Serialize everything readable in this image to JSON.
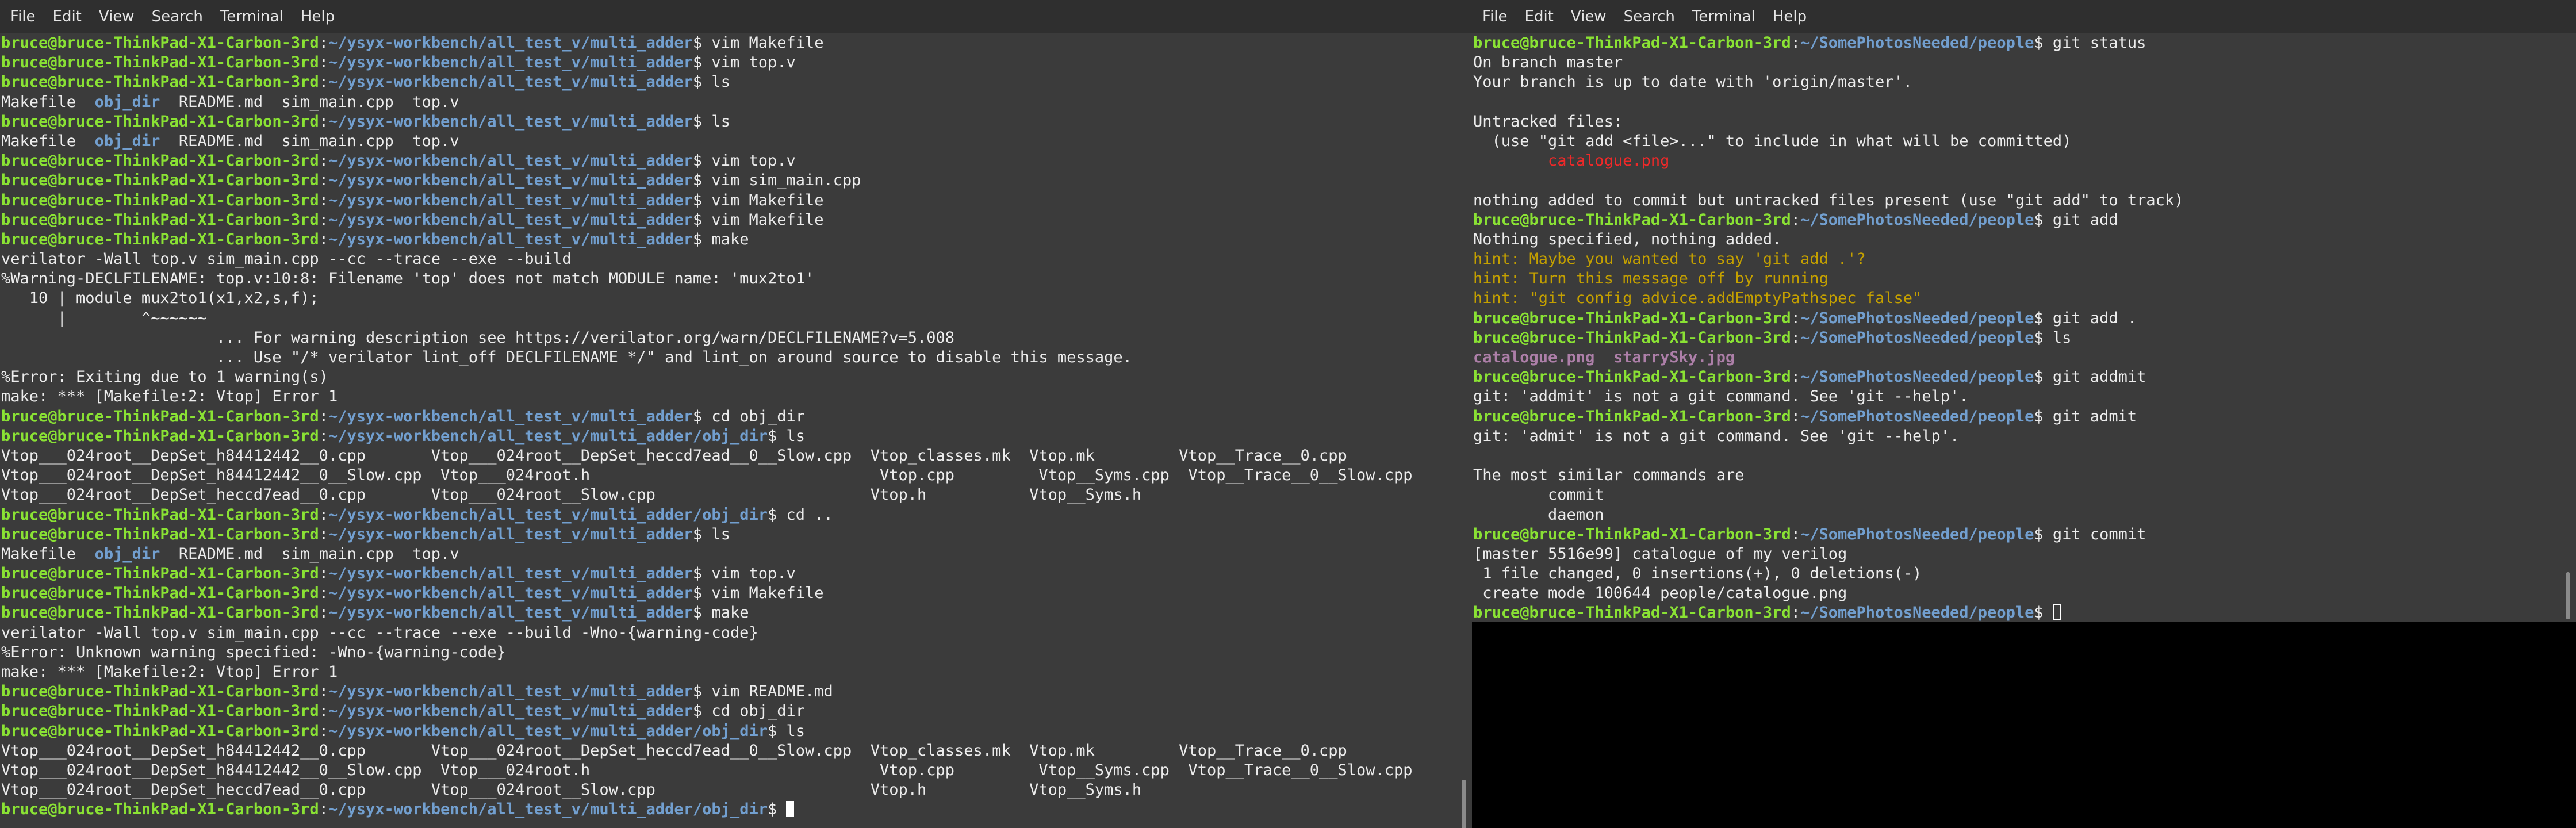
{
  "menu": [
    "File",
    "Edit",
    "View",
    "Search",
    "Terminal",
    "Help"
  ],
  "colors": {
    "user": "#8ae234",
    "path": "#729fcf",
    "dir": "#729fcf",
    "image_file": "#ad7fa8",
    "untracked": "#ef2929",
    "hint": "#c4a000",
    "terminal_bg": "#3b3b3b",
    "text": "#ececec"
  },
  "left_terminal": {
    "prompt_user": "bruce@bruce-ThinkPad-X1-Carbon-3rd",
    "lines": [
      [
        [
          "u",
          "bruce@bruce-ThinkPad-X1-Carbon-3rd"
        ],
        [
          "t",
          ":"
        ],
        [
          "p",
          "~/ysyx-workbench/all_test_v/multi_adder"
        ],
        [
          "t",
          "$ vim Makefile"
        ]
      ],
      [
        [
          "u",
          "bruce@bruce-ThinkPad-X1-Carbon-3rd"
        ],
        [
          "t",
          ":"
        ],
        [
          "p",
          "~/ysyx-workbench/all_test_v/multi_adder"
        ],
        [
          "t",
          "$ vim top.v"
        ]
      ],
      [
        [
          "u",
          "bruce@bruce-ThinkPad-X1-Carbon-3rd"
        ],
        [
          "t",
          ":"
        ],
        [
          "p",
          "~/ysyx-workbench/all_test_v/multi_adder"
        ],
        [
          "t",
          "$ ls"
        ]
      ],
      [
        [
          "t",
          "Makefile  "
        ],
        [
          "d",
          "obj_dir"
        ],
        [
          "t",
          "  README.md  sim_main.cpp  top.v"
        ]
      ],
      [
        [
          "u",
          "bruce@bruce-ThinkPad-X1-Carbon-3rd"
        ],
        [
          "t",
          ":"
        ],
        [
          "p",
          "~/ysyx-workbench/all_test_v/multi_adder"
        ],
        [
          "t",
          "$ ls"
        ]
      ],
      [
        [
          "t",
          "Makefile  "
        ],
        [
          "d",
          "obj_dir"
        ],
        [
          "t",
          "  README.md  sim_main.cpp  top.v"
        ]
      ],
      [
        [
          "u",
          "bruce@bruce-ThinkPad-X1-Carbon-3rd"
        ],
        [
          "t",
          ":"
        ],
        [
          "p",
          "~/ysyx-workbench/all_test_v/multi_adder"
        ],
        [
          "t",
          "$ vim top.v"
        ]
      ],
      [
        [
          "u",
          "bruce@bruce-ThinkPad-X1-Carbon-3rd"
        ],
        [
          "t",
          ":"
        ],
        [
          "p",
          "~/ysyx-workbench/all_test_v/multi_adder"
        ],
        [
          "t",
          "$ vim sim_main.cpp"
        ]
      ],
      [
        [
          "u",
          "bruce@bruce-ThinkPad-X1-Carbon-3rd"
        ],
        [
          "t",
          ":"
        ],
        [
          "p",
          "~/ysyx-workbench/all_test_v/multi_adder"
        ],
        [
          "t",
          "$ vim Makefile"
        ]
      ],
      [
        [
          "u",
          "bruce@bruce-ThinkPad-X1-Carbon-3rd"
        ],
        [
          "t",
          ":"
        ],
        [
          "p",
          "~/ysyx-workbench/all_test_v/multi_adder"
        ],
        [
          "t",
          "$ vim Makefile"
        ]
      ],
      [
        [
          "u",
          "bruce@bruce-ThinkPad-X1-Carbon-3rd"
        ],
        [
          "t",
          ":"
        ],
        [
          "p",
          "~/ysyx-workbench/all_test_v/multi_adder"
        ],
        [
          "t",
          "$ make"
        ]
      ],
      [
        [
          "t",
          "verilator -Wall top.v sim_main.cpp --cc --trace --exe --build"
        ]
      ],
      [
        [
          "t",
          "%Warning-DECLFILENAME: top.v:10:8: Filename 'top' does not match MODULE name: 'mux2to1'"
        ]
      ],
      [
        [
          "t",
          "   10 | module mux2to1(x1,x2,s,f);"
        ]
      ],
      [
        [
          "t",
          "      |        ^~~~~~~"
        ]
      ],
      [
        [
          "t",
          "                       ... For warning description see https://verilator.org/warn/DECLFILENAME?v=5.008"
        ]
      ],
      [
        [
          "t",
          "                       ... Use \"/* verilator lint_off DECLFILENAME */\" and lint_on around source to disable this message."
        ]
      ],
      [
        [
          "t",
          "%Error: Exiting due to 1 warning(s)"
        ]
      ],
      [
        [
          "t",
          "make: *** [Makefile:2: Vtop] Error 1"
        ]
      ],
      [
        [
          "u",
          "bruce@bruce-ThinkPad-X1-Carbon-3rd"
        ],
        [
          "t",
          ":"
        ],
        [
          "p",
          "~/ysyx-workbench/all_test_v/multi_adder"
        ],
        [
          "t",
          "$ cd obj_dir"
        ]
      ],
      [
        [
          "u",
          "bruce@bruce-ThinkPad-X1-Carbon-3rd"
        ],
        [
          "t",
          ":"
        ],
        [
          "p",
          "~/ysyx-workbench/all_test_v/multi_adder/obj_dir"
        ],
        [
          "t",
          "$ ls"
        ]
      ],
      [
        [
          "t",
          "Vtop___024root__DepSet_h84412442__0.cpp       Vtop___024root__DepSet_heccd7ead__0__Slow.cpp  Vtop_classes.mk  Vtop.mk         Vtop__Trace__0.cpp"
        ]
      ],
      [
        [
          "t",
          "Vtop___024root__DepSet_h84412442__0__Slow.cpp  Vtop___024root.h                               Vtop.cpp         Vtop__Syms.cpp  Vtop__Trace__0__Slow.cpp"
        ]
      ],
      [
        [
          "t",
          "Vtop___024root__DepSet_heccd7ead__0.cpp       Vtop___024root__Slow.cpp                       Vtop.h           Vtop__Syms.h"
        ]
      ],
      [
        [
          "u",
          "bruce@bruce-ThinkPad-X1-Carbon-3rd"
        ],
        [
          "t",
          ":"
        ],
        [
          "p",
          "~/ysyx-workbench/all_test_v/multi_adder/obj_dir"
        ],
        [
          "t",
          "$ cd .."
        ]
      ],
      [
        [
          "u",
          "bruce@bruce-ThinkPad-X1-Carbon-3rd"
        ],
        [
          "t",
          ":"
        ],
        [
          "p",
          "~/ysyx-workbench/all_test_v/multi_adder"
        ],
        [
          "t",
          "$ ls"
        ]
      ],
      [
        [
          "t",
          "Makefile  "
        ],
        [
          "d",
          "obj_dir"
        ],
        [
          "t",
          "  README.md  sim_main.cpp  top.v"
        ]
      ],
      [
        [
          "u",
          "bruce@bruce-ThinkPad-X1-Carbon-3rd"
        ],
        [
          "t",
          ":"
        ],
        [
          "p",
          "~/ysyx-workbench/all_test_v/multi_adder"
        ],
        [
          "t",
          "$ vim top.v"
        ]
      ],
      [
        [
          "u",
          "bruce@bruce-ThinkPad-X1-Carbon-3rd"
        ],
        [
          "t",
          ":"
        ],
        [
          "p",
          "~/ysyx-workbench/all_test_v/multi_adder"
        ],
        [
          "t",
          "$ vim Makefile"
        ]
      ],
      [
        [
          "u",
          "bruce@bruce-ThinkPad-X1-Carbon-3rd"
        ],
        [
          "t",
          ":"
        ],
        [
          "p",
          "~/ysyx-workbench/all_test_v/multi_adder"
        ],
        [
          "t",
          "$ make"
        ]
      ],
      [
        [
          "t",
          "verilator -Wall top.v sim_main.cpp --cc --trace --exe --build -Wno-{warning-code}"
        ]
      ],
      [
        [
          "t",
          "%Error: Unknown warning specified: -Wno-{warning-code}"
        ]
      ],
      [
        [
          "t",
          "make: *** [Makefile:2: Vtop] Error 1"
        ]
      ],
      [
        [
          "u",
          "bruce@bruce-ThinkPad-X1-Carbon-3rd"
        ],
        [
          "t",
          ":"
        ],
        [
          "p",
          "~/ysyx-workbench/all_test_v/multi_adder"
        ],
        [
          "t",
          "$ vim README.md"
        ]
      ],
      [
        [
          "u",
          "bruce@bruce-ThinkPad-X1-Carbon-3rd"
        ],
        [
          "t",
          ":"
        ],
        [
          "p",
          "~/ysyx-workbench/all_test_v/multi_adder"
        ],
        [
          "t",
          "$ cd obj_dir"
        ]
      ],
      [
        [
          "u",
          "bruce@bruce-ThinkPad-X1-Carbon-3rd"
        ],
        [
          "t",
          ":"
        ],
        [
          "p",
          "~/ysyx-workbench/all_test_v/multi_adder/obj_dir"
        ],
        [
          "t",
          "$ ls"
        ]
      ],
      [
        [
          "t",
          "Vtop___024root__DepSet_h84412442__0.cpp       Vtop___024root__DepSet_heccd7ead__0__Slow.cpp  Vtop_classes.mk  Vtop.mk         Vtop__Trace__0.cpp"
        ]
      ],
      [
        [
          "t",
          "Vtop___024root__DepSet_h84412442__0__Slow.cpp  Vtop___024root.h                               Vtop.cpp         Vtop__Syms.cpp  Vtop__Trace__0__Slow.cpp"
        ]
      ],
      [
        [
          "t",
          "Vtop___024root__DepSet_heccd7ead__0.cpp       Vtop___024root__Slow.cpp                       Vtop.h           Vtop__Syms.h"
        ]
      ],
      [
        [
          "u",
          "bruce@bruce-ThinkPad-X1-Carbon-3rd"
        ],
        [
          "t",
          ":"
        ],
        [
          "p",
          "~/ysyx-workbench/all_test_v/multi_adder/obj_dir"
        ],
        [
          "t",
          "$ "
        ],
        [
          "c",
          "solid"
        ]
      ]
    ]
  },
  "right_terminal": {
    "lines": [
      [
        [
          "u",
          "bruce@bruce-ThinkPad-X1-Carbon-3rd"
        ],
        [
          "t",
          ":"
        ],
        [
          "p",
          "~/SomePhotosNeeded/people"
        ],
        [
          "t",
          "$ git status"
        ]
      ],
      [
        [
          "t",
          "On branch master"
        ]
      ],
      [
        [
          "t",
          "Your branch is up to date with 'origin/master'."
        ]
      ],
      [
        [
          "t",
          ""
        ]
      ],
      [
        [
          "t",
          "Untracked files:"
        ]
      ],
      [
        [
          "t",
          "  (use \"git add <file>...\" to include in what will be committed)"
        ]
      ],
      [
        [
          "t",
          "        "
        ],
        [
          "r",
          "catalogue.png"
        ]
      ],
      [
        [
          "t",
          ""
        ]
      ],
      [
        [
          "t",
          "nothing added to commit but untracked files present (use \"git add\" to track)"
        ]
      ],
      [
        [
          "u",
          "bruce@bruce-ThinkPad-X1-Carbon-3rd"
        ],
        [
          "t",
          ":"
        ],
        [
          "p",
          "~/SomePhotosNeeded/people"
        ],
        [
          "t",
          "$ git add"
        ]
      ],
      [
        [
          "t",
          "Nothing specified, nothing added."
        ]
      ],
      [
        [
          "h",
          "hint: Maybe you wanted to say 'git add .'?"
        ]
      ],
      [
        [
          "h",
          "hint: Turn this message off by running"
        ]
      ],
      [
        [
          "h",
          "hint: \"git config advice.addEmptyPathspec false\""
        ]
      ],
      [
        [
          "u",
          "bruce@bruce-ThinkPad-X1-Carbon-3rd"
        ],
        [
          "t",
          ":"
        ],
        [
          "p",
          "~/SomePhotosNeeded/people"
        ],
        [
          "t",
          "$ git add ."
        ]
      ],
      [
        [
          "u",
          "bruce@bruce-ThinkPad-X1-Carbon-3rd"
        ],
        [
          "t",
          ":"
        ],
        [
          "p",
          "~/SomePhotosNeeded/people"
        ],
        [
          "t",
          "$ ls"
        ]
      ],
      [
        [
          "i",
          "catalogue.png"
        ],
        [
          "t",
          "  "
        ],
        [
          "i",
          "starrySky.jpg"
        ]
      ],
      [
        [
          "u",
          "bruce@bruce-ThinkPad-X1-Carbon-3rd"
        ],
        [
          "t",
          ":"
        ],
        [
          "p",
          "~/SomePhotosNeeded/people"
        ],
        [
          "t",
          "$ git addmit"
        ]
      ],
      [
        [
          "t",
          "git: 'addmit' is not a git command. See 'git --help'."
        ]
      ],
      [
        [
          "u",
          "bruce@bruce-ThinkPad-X1-Carbon-3rd"
        ],
        [
          "t",
          ":"
        ],
        [
          "p",
          "~/SomePhotosNeeded/people"
        ],
        [
          "t",
          "$ git admit"
        ]
      ],
      [
        [
          "t",
          "git: 'admit' is not a git command. See 'git --help'."
        ]
      ],
      [
        [
          "t",
          ""
        ]
      ],
      [
        [
          "t",
          "The most similar commands are"
        ]
      ],
      [
        [
          "t",
          "        commit"
        ]
      ],
      [
        [
          "t",
          "        daemon"
        ]
      ],
      [
        [
          "u",
          "bruce@bruce-ThinkPad-X1-Carbon-3rd"
        ],
        [
          "t",
          ":"
        ],
        [
          "p",
          "~/SomePhotosNeeded/people"
        ],
        [
          "t",
          "$ git commit"
        ]
      ],
      [
        [
          "t",
          "[master 5516e99] catalogue of my verilog"
        ]
      ],
      [
        [
          "t",
          " 1 file changed, 0 insertions(+), 0 deletions(-)"
        ]
      ],
      [
        [
          "t",
          " create mode 100644 people/catalogue.png"
        ]
      ],
      [
        [
          "u",
          "bruce@bruce-ThinkPad-X1-Carbon-3rd"
        ],
        [
          "t",
          ":"
        ],
        [
          "p",
          "~/SomePhotosNeeded/people"
        ],
        [
          "t",
          "$ "
        ],
        [
          "c",
          "outline"
        ]
      ]
    ]
  }
}
